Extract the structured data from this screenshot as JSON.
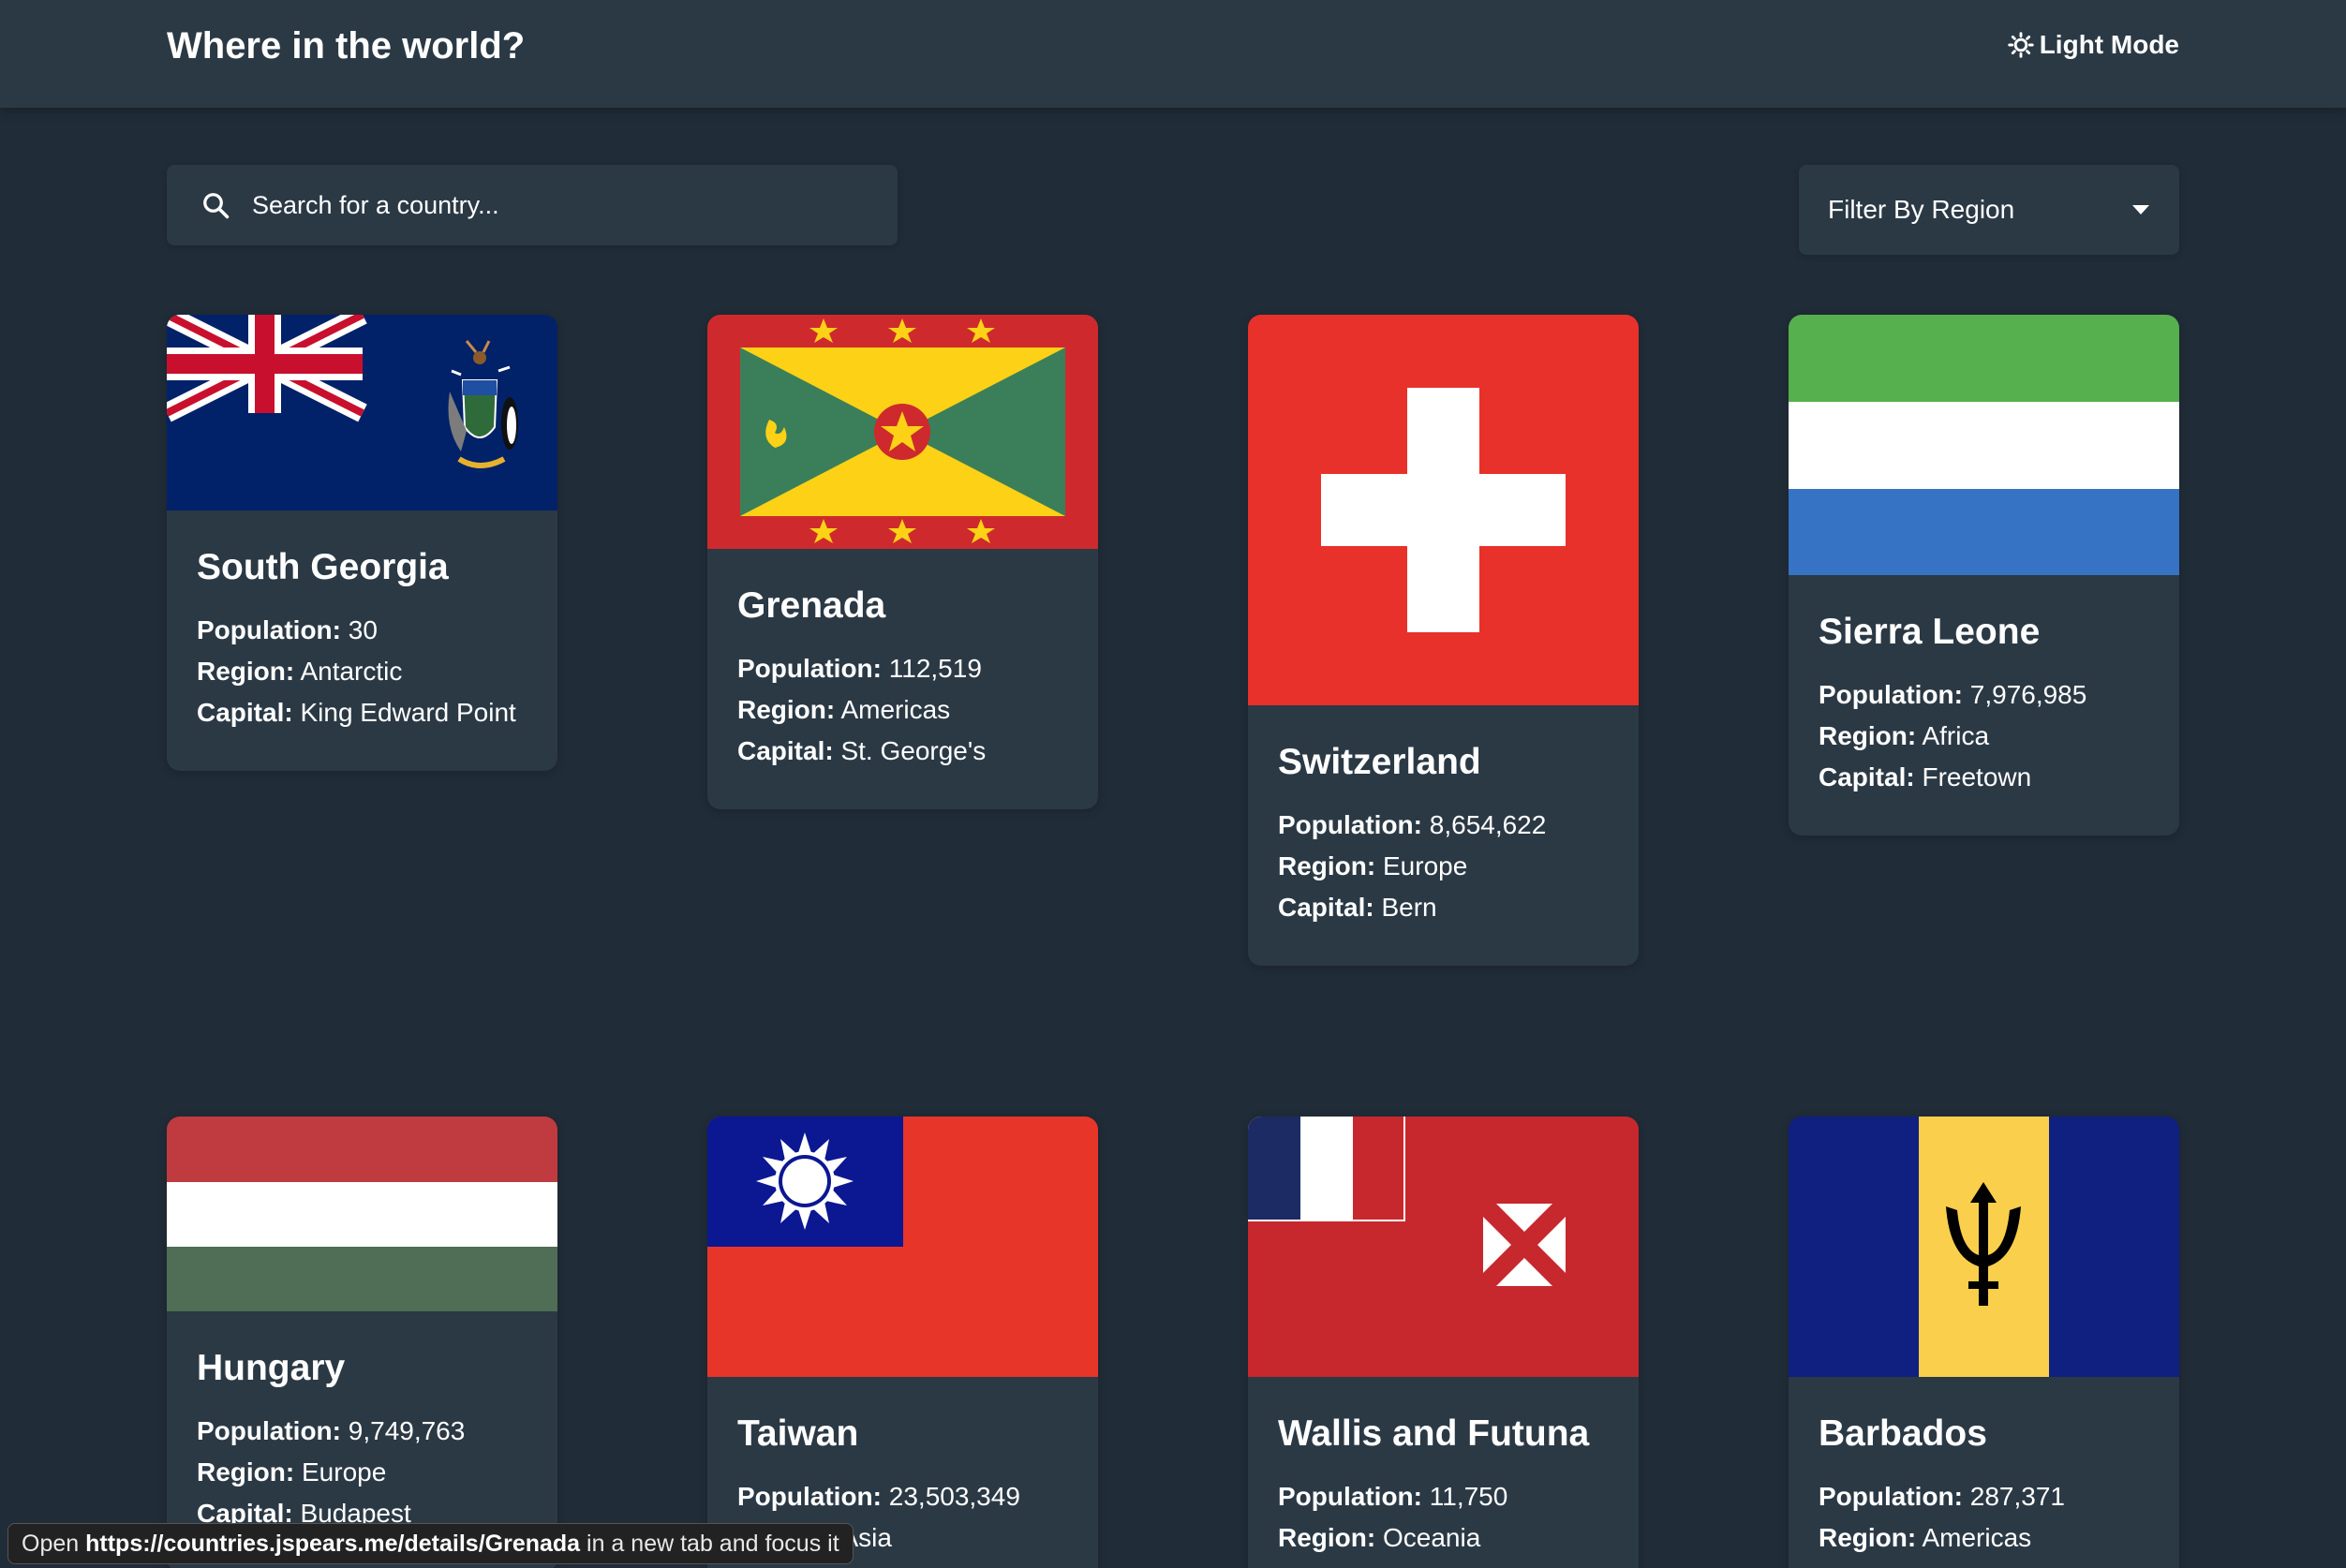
{
  "header": {
    "title": "Where in the world?",
    "theme_toggle_label": "Light Mode"
  },
  "search": {
    "placeholder": "Search for a country...",
    "value": ""
  },
  "filter": {
    "label": "Filter By Region"
  },
  "labels": {
    "population": "Population:",
    "region": "Region:",
    "capital": "Capital:"
  },
  "countries": [
    {
      "name": "South Georgia",
      "population": "30",
      "region": "Antarctic",
      "capital": "King Edward Point"
    },
    {
      "name": "Grenada",
      "population": "112,519",
      "region": "Americas",
      "capital": "St. George's"
    },
    {
      "name": "Switzerland",
      "population": "8,654,622",
      "region": "Europe",
      "capital": "Bern"
    },
    {
      "name": "Sierra Leone",
      "population": "7,976,985",
      "region": "Africa",
      "capital": "Freetown"
    },
    {
      "name": "Hungary",
      "population": "9,749,763",
      "region": "Europe",
      "capital": "Budapest"
    },
    {
      "name": "Taiwan",
      "population": "23,503,349",
      "region": "Asia",
      "capital": ""
    },
    {
      "name": "Wallis and Futuna",
      "population": "11,750",
      "region": "Oceania",
      "capital": ""
    },
    {
      "name": "Barbados",
      "population": "287,371",
      "region": "Americas",
      "capital": ""
    }
  ],
  "status_bar": {
    "prefix": "Open",
    "url": "https://countries.jspears.me/details/Grenada",
    "suffix": "in a new tab and focus it"
  },
  "colors": {
    "background": "#202c37",
    "surface": "#2b3945",
    "text": "#ffffff"
  }
}
